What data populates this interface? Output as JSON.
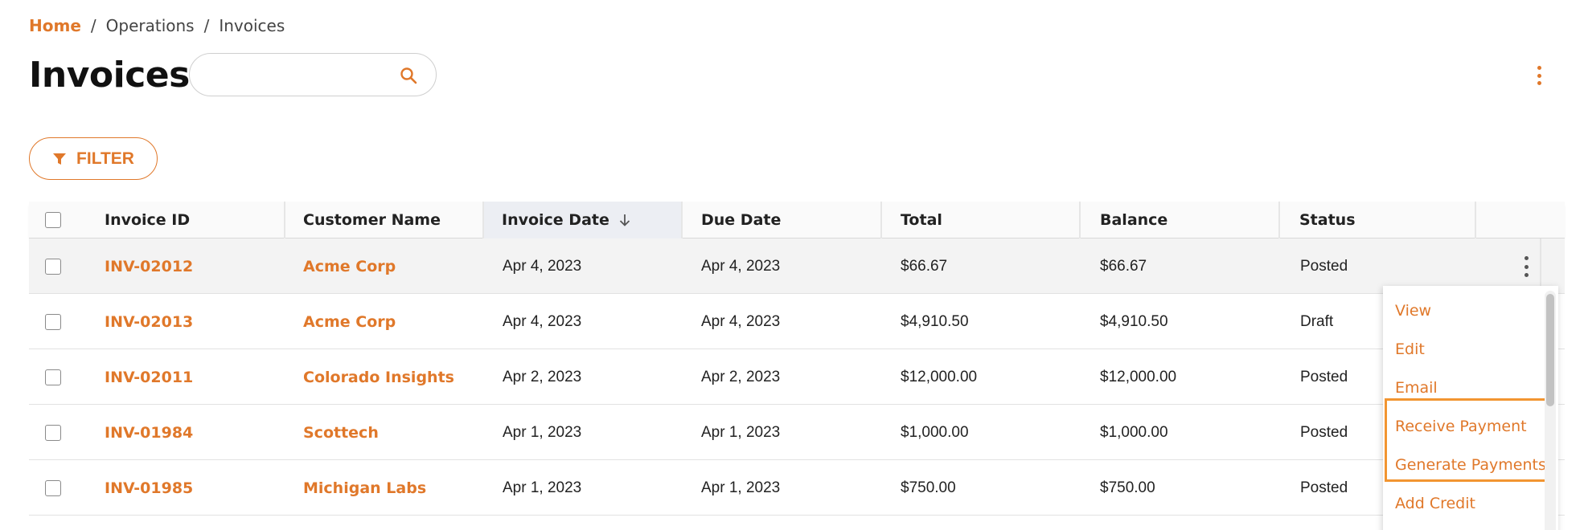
{
  "breadcrumb": {
    "home": "Home",
    "separator": "/",
    "items": [
      "Operations",
      "Invoices"
    ]
  },
  "page": {
    "title": "Invoices"
  },
  "search": {
    "value": "",
    "placeholder": ""
  },
  "toolbar": {
    "filter_label": "FILTER"
  },
  "table": {
    "columns": [
      "Invoice ID",
      "Customer Name",
      "Invoice Date",
      "Due Date",
      "Total",
      "Balance",
      "Status"
    ],
    "sorted_column": "Invoice Date",
    "sort_direction": "descending",
    "rows": [
      {
        "id": "INV-02012",
        "customer": "Acme Corp",
        "invoice_date": "Apr 4, 2023",
        "due_date": "Apr 4, 2023",
        "total": "$66.67",
        "balance": "$66.67",
        "status": "Posted"
      },
      {
        "id": "INV-02013",
        "customer": "Acme Corp",
        "invoice_date": "Apr 4, 2023",
        "due_date": "Apr 4, 2023",
        "total": "$4,910.50",
        "balance": "$4,910.50",
        "status": "Draft"
      },
      {
        "id": "INV-02011",
        "customer": "Colorado Insights",
        "invoice_date": "Apr 2, 2023",
        "due_date": "Apr 2, 2023",
        "total": "$12,000.00",
        "balance": "$12,000.00",
        "status": "Posted"
      },
      {
        "id": "INV-01984",
        "customer": "Scottech",
        "invoice_date": "Apr 1, 2023",
        "due_date": "Apr 1, 2023",
        "total": "$1,000.00",
        "balance": "$1,000.00",
        "status": "Posted"
      },
      {
        "id": "INV-01985",
        "customer": "Michigan Labs",
        "invoice_date": "Apr 1, 2023",
        "due_date": "Apr 1, 2023",
        "total": "$750.00",
        "balance": "$750.00",
        "status": "Posted"
      }
    ]
  },
  "row_menu": {
    "items": [
      "View",
      "Edit",
      "Email",
      "Receive Payment",
      "Generate Payments",
      "Add Credit"
    ],
    "highlighted": [
      "Receive Payment",
      "Generate Payments"
    ]
  },
  "colors": {
    "accent": "#e0782a",
    "highlight_border": "#f29531",
    "sorted_header_bg": "#eceef3"
  },
  "icons": {
    "search": "search-icon",
    "filter": "filter-icon",
    "sort": "arrow-down-icon",
    "more": "more-vertical-icon"
  }
}
